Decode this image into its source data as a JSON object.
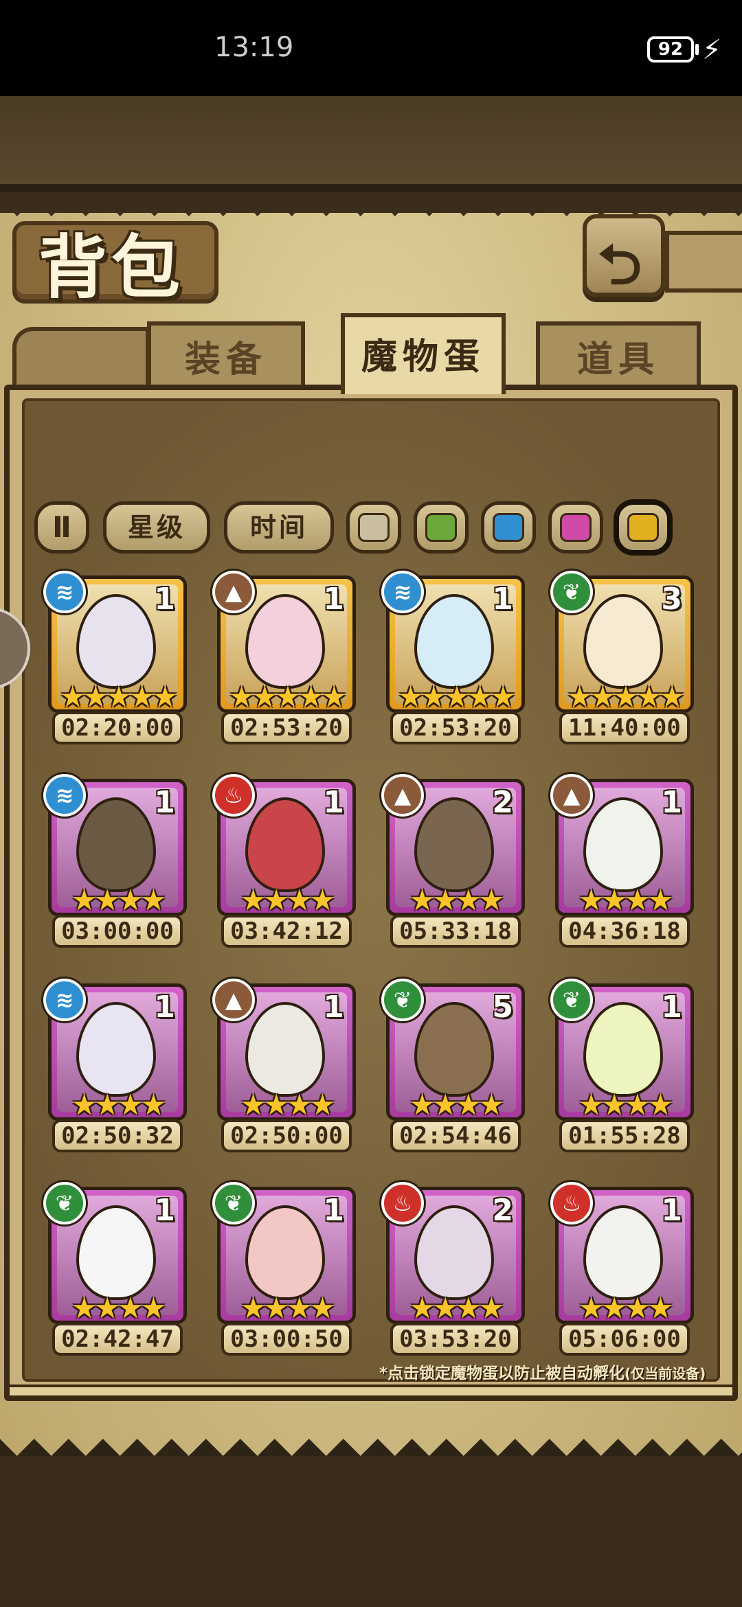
{
  "status_bar": {
    "time": "13:19",
    "battery": "92"
  },
  "header": {
    "title": "背包",
    "back_icon": "back-arrow-icon"
  },
  "tabs": [
    {
      "label": "装备",
      "active": false
    },
    {
      "label": "魔物蛋",
      "active": true
    },
    {
      "label": "道具",
      "active": false
    }
  ],
  "filters": {
    "toggle_icon": "Ⅱ",
    "star_label": "星级",
    "time_label": "时间",
    "colors": [
      "#c9bfa0",
      "#6aa83a",
      "#2f8fd0",
      "#d04aa8",
      "#e0b020"
    ],
    "selected_color": 4
  },
  "eggs": [
    {
      "element": "water",
      "count": "1",
      "rarity": "gold",
      "stars": "★★★★★",
      "timer": "02:20:00",
      "color": "#e8e2ee"
    },
    {
      "element": "earth",
      "count": "1",
      "rarity": "gold",
      "stars": "★★★★★",
      "timer": "02:53:20",
      "color": "#f3d0dc"
    },
    {
      "element": "water",
      "count": "1",
      "rarity": "gold",
      "stars": "★★★★★",
      "timer": "02:53:20",
      "color": "#d6ecf7"
    },
    {
      "element": "grass",
      "count": "3",
      "rarity": "gold",
      "stars": "★★★★★",
      "timer": "11:40:00",
      "color": "#f6ead2"
    },
    {
      "element": "water",
      "count": "1",
      "rarity": "purple",
      "stars": "★★★★",
      "timer": "03:00:00",
      "color": "#6a5a44"
    },
    {
      "element": "fire",
      "count": "1",
      "rarity": "purple",
      "stars": "★★★★",
      "timer": "03:42:12",
      "color": "#c9454a"
    },
    {
      "element": "earth",
      "count": "2",
      "rarity": "purple",
      "stars": "★★★★",
      "timer": "05:33:18",
      "color": "#7a6650"
    },
    {
      "element": "earth",
      "count": "1",
      "rarity": "purple",
      "stars": "★★★★",
      "timer": "04:36:18",
      "color": "#f0f2ec"
    },
    {
      "element": "water",
      "count": "1",
      "rarity": "purple",
      "stars": "★★★★",
      "timer": "02:50:32",
      "color": "#e8e4f2"
    },
    {
      "element": "earth",
      "count": "1",
      "rarity": "purple",
      "stars": "★★★★",
      "timer": "02:50:00",
      "color": "#ece8e2"
    },
    {
      "element": "grass",
      "count": "5",
      "rarity": "purple",
      "stars": "★★★★",
      "timer": "02:54:46",
      "color": "#8a7050"
    },
    {
      "element": "grass",
      "count": "1",
      "rarity": "purple",
      "stars": "★★★★",
      "timer": "01:55:28",
      "color": "#eef4c0"
    },
    {
      "element": "grass",
      "count": "1",
      "rarity": "purple",
      "stars": "★★★★",
      "timer": "02:42:47",
      "color": "#f6f6f6"
    },
    {
      "element": "grass",
      "count": "1",
      "rarity": "purple",
      "stars": "★★★★",
      "timer": "03:00:50",
      "color": "#f3c7c4"
    },
    {
      "element": "fire",
      "count": "2",
      "rarity": "purple",
      "stars": "★★★★",
      "timer": "03:53:20",
      "color": "#e4d8e6"
    },
    {
      "element": "fire",
      "count": "1",
      "rarity": "purple",
      "stars": "★★★★",
      "timer": "05:06:00",
      "color": "#f4f2ee"
    }
  ],
  "note": {
    "main": "*点击锁定魔物蛋以防止被自动孵化",
    "sub": "(仅当前设备)"
  }
}
